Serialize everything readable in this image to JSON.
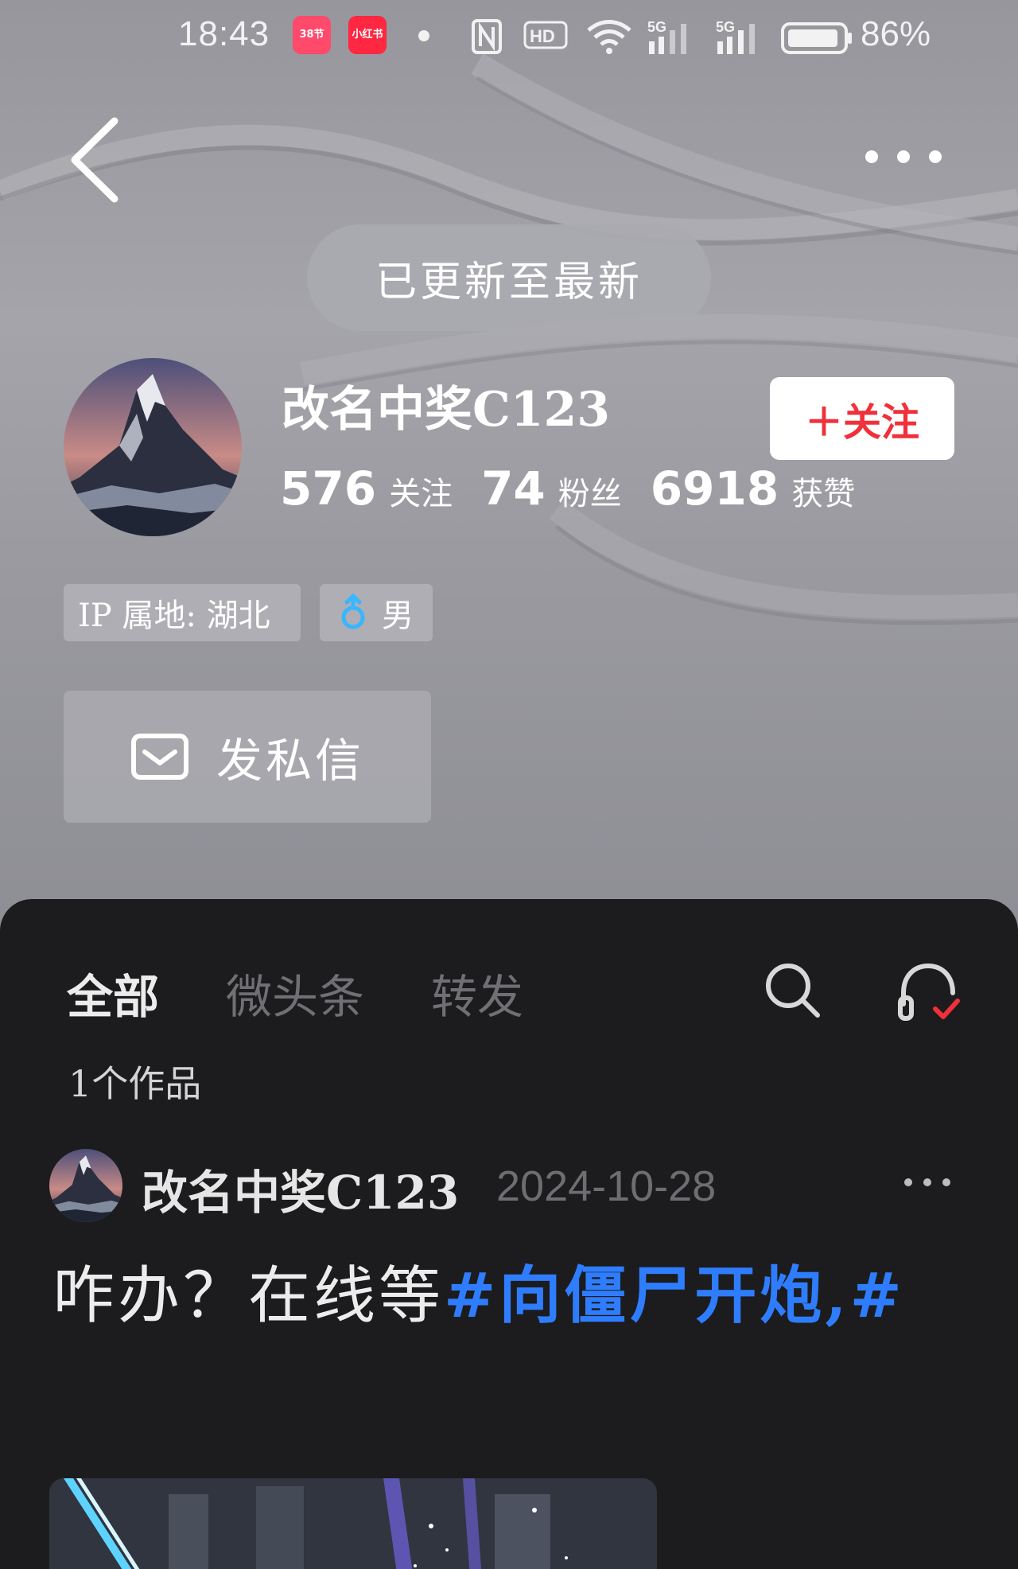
{
  "status_bar": {
    "time": "18:43",
    "badge1_text": "38节",
    "badge2_text": "小红书",
    "battery_percent": "86%",
    "icons": [
      "nfc-icon",
      "hd-icon",
      "wifi-icon",
      "signal-5g-icon",
      "signal-5g-icon",
      "battery-icon"
    ]
  },
  "nav": {
    "back_icon": "chevron-left-icon",
    "more_icon": "more-horizontal-icon"
  },
  "toast": {
    "text": "已更新至最新"
  },
  "profile": {
    "username": "改名中奖C123",
    "follow_button": "＋关注",
    "following_count": "576",
    "following_label": "关注",
    "fans_count": "74",
    "fans_label": "粉丝",
    "likes_count": "6918",
    "likes_label": "获赞",
    "ip_tag": "IP 属地: 湖北",
    "gender_tag": "男",
    "message_button": "发私信"
  },
  "content": {
    "tabs": [
      {
        "label": "全部",
        "active": true
      },
      {
        "label": "微头条",
        "active": false
      },
      {
        "label": "转发",
        "active": false
      }
    ],
    "work_count": "1个作品",
    "post": {
      "author": "改名中奖C123",
      "date": "2024-10-28",
      "text_plain": "咋办？在线等",
      "text_hashtag": "#向僵尸开炮,#"
    }
  },
  "colors": {
    "accent_red": "#f0303a",
    "hashtag_blue": "#2f7dff",
    "panel_bg": "#1c1c1e",
    "header_bg": "#9a9aa0"
  }
}
